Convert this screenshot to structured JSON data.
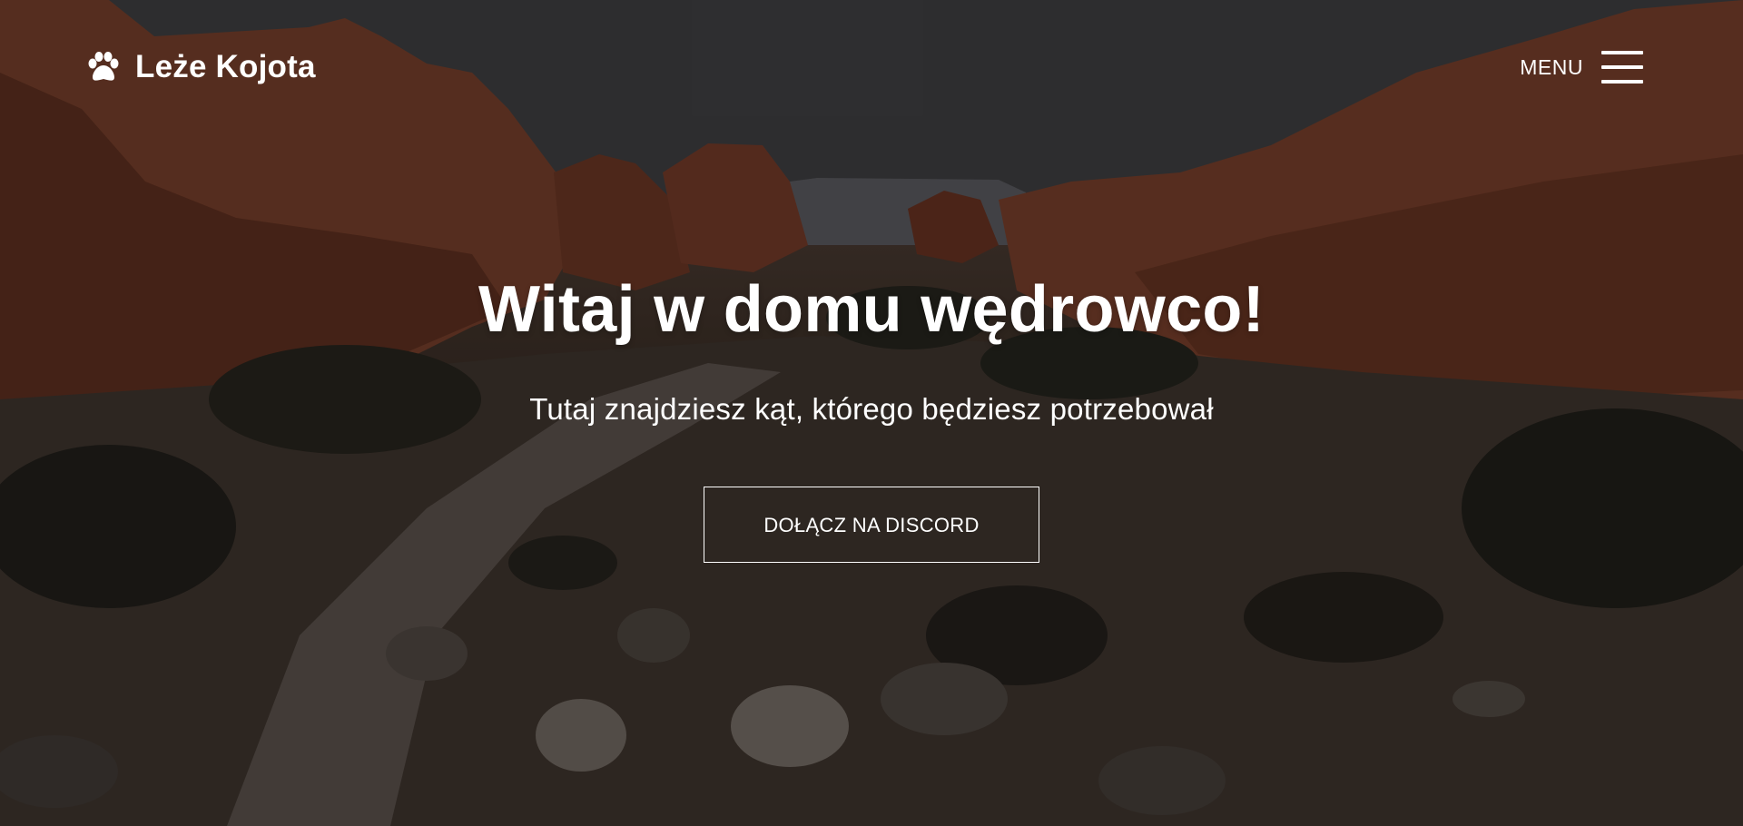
{
  "navbar": {
    "brand_text": "Leże Kojota",
    "brand_icon": "paw-icon",
    "menu_label": "MENU",
    "menu_icon": "hamburger-icon"
  },
  "hero": {
    "title": "Witaj w domu wędrowco!",
    "subtitle": "Tutaj znajdziesz kąt, którego będziesz potrzebował",
    "cta_label": "DOŁĄCZ NA DISCORD"
  },
  "colors": {
    "text": "#ffffff",
    "overlay": "rgba(0,0,0,0.38)",
    "rock": "#7a3f2a",
    "ground": "#3a322c"
  }
}
